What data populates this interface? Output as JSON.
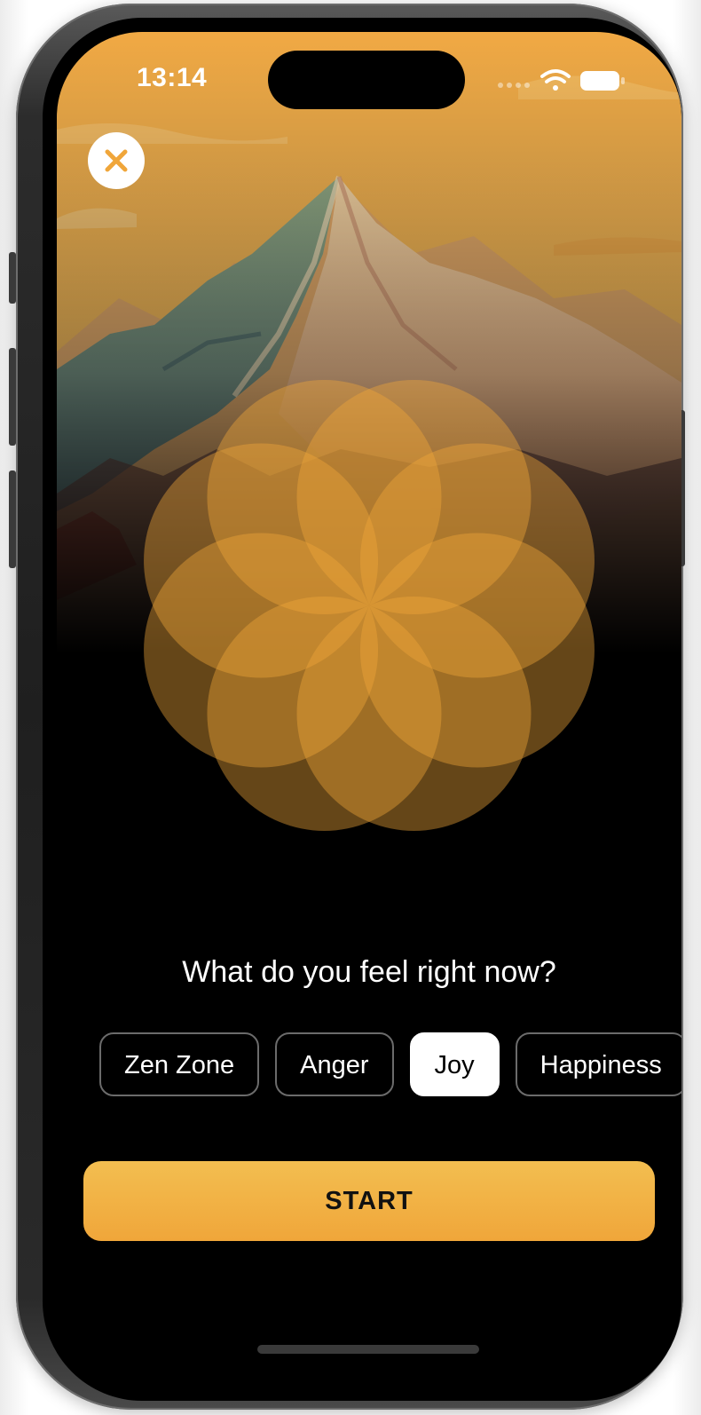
{
  "status_bar": {
    "time": "13:14",
    "icons": [
      "cellular-dots-icon",
      "wifi-icon",
      "battery-icon"
    ]
  },
  "close_button": {
    "icon": "close-icon"
  },
  "background": {
    "artwork": "mountain-sunset",
    "colors": {
      "sky_top": "#f1a944",
      "sky_bottom": "#f6c770",
      "peak_light": "#f3cf9a",
      "peak_green": "#8fa67f",
      "fade_to": "#000000"
    }
  },
  "breathing_flower": {
    "petals": 8,
    "color": "#f0a63a"
  },
  "mood": {
    "question": "What do you feel right now?",
    "options": [
      {
        "label": "Zen Zone",
        "selected": false
      },
      {
        "label": "Anger",
        "selected": false
      },
      {
        "label": "Joy",
        "selected": true
      },
      {
        "label": "Happiness",
        "selected": false
      }
    ]
  },
  "start_button": {
    "label": "START",
    "color": "#f0a63a"
  }
}
